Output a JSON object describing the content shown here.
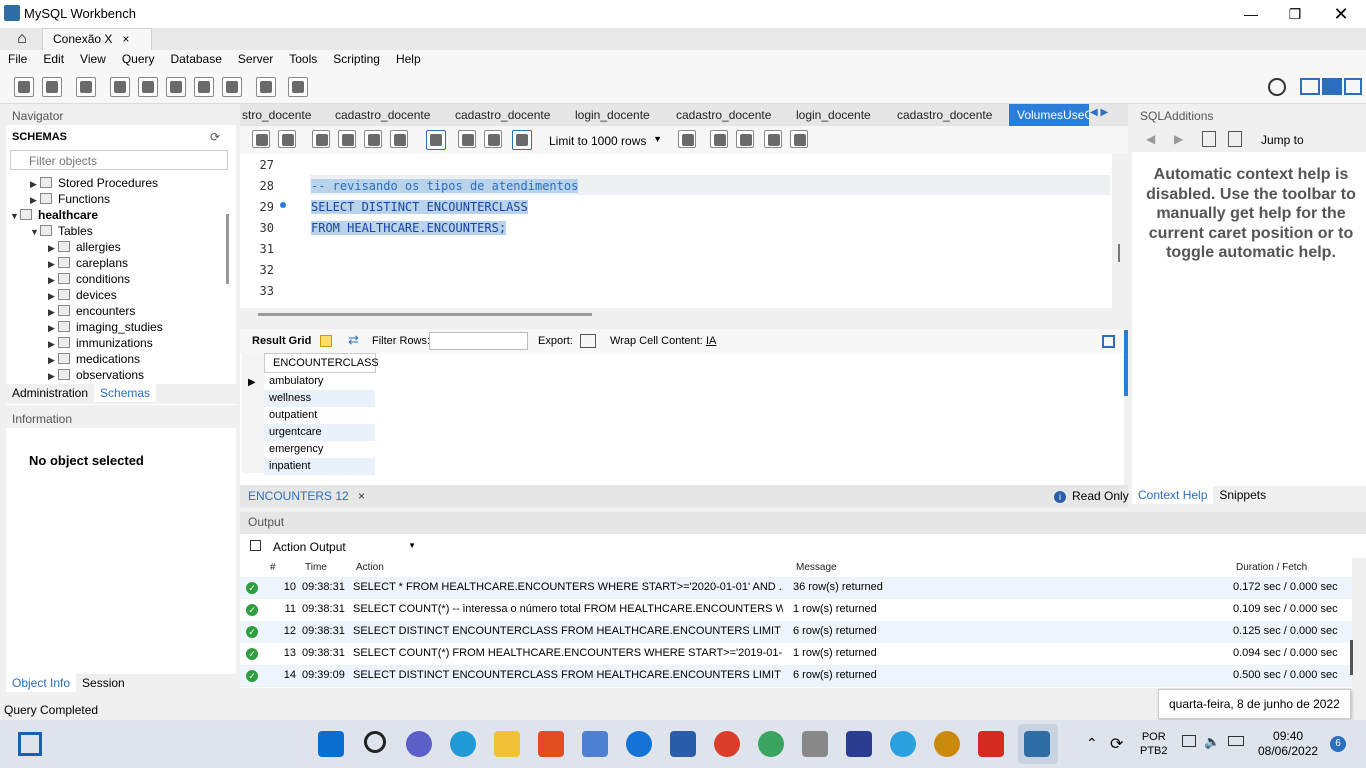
{
  "window": {
    "title": "MySQL Workbench"
  },
  "connection_tab": {
    "label": "Conexão X",
    "close": "×"
  },
  "menu": [
    "File",
    "Edit",
    "View",
    "Query",
    "Database",
    "Server",
    "Tools",
    "Scripting",
    "Help"
  ],
  "navigator": {
    "header": "Navigator",
    "schemas_title": "SCHEMAS",
    "filter_placeholder": "Filter objects",
    "tree": [
      {
        "label": "Stored Procedures",
        "level": 1,
        "bold": false
      },
      {
        "label": "Functions",
        "level": 1,
        "bold": false
      },
      {
        "label": "healthcare",
        "level": 0,
        "bold": true
      },
      {
        "label": "Tables",
        "level": 1,
        "bold": false
      },
      {
        "label": "allergies",
        "level": 2,
        "bold": false
      },
      {
        "label": "careplans",
        "level": 2,
        "bold": false
      },
      {
        "label": "conditions",
        "level": 2,
        "bold": false
      },
      {
        "label": "devices",
        "level": 2,
        "bold": false
      },
      {
        "label": "encounters",
        "level": 2,
        "bold": false
      },
      {
        "label": "imaging_studies",
        "level": 2,
        "bold": false
      },
      {
        "label": "immunizations",
        "level": 2,
        "bold": false
      },
      {
        "label": "medications",
        "level": 2,
        "bold": false
      },
      {
        "label": "observations",
        "level": 2,
        "bold": false
      }
    ],
    "tabs": [
      "Administration",
      "Schemas"
    ]
  },
  "information": {
    "header": "Information",
    "empty": "No object selected",
    "tabs": [
      "Object Info",
      "Session"
    ]
  },
  "query_tabs": [
    "stro_docente",
    "cadastro_docente",
    "cadastro_docente",
    "login_docente",
    "cadastro_docente",
    "login_docente",
    "cadastro_docente",
    "VolumesUseC"
  ],
  "editor_toolbar": {
    "limit": "Limit to 1000 rows"
  },
  "editor": {
    "lines": [
      {
        "n": "27",
        "code": "",
        "kind": ""
      },
      {
        "n": "28",
        "code": "-- revisando os tipos de atendimentos",
        "kind": "cm"
      },
      {
        "n": "29",
        "code": "SELECT DISTINCT ENCOUNTERCLASS",
        "kind": "sel1"
      },
      {
        "n": "30",
        "code": "FROM HEALTHCARE.ENCOUNTERS;",
        "kind": "sel2"
      },
      {
        "n": "31",
        "code": "",
        "kind": ""
      },
      {
        "n": "32",
        "code": "",
        "kind": ""
      },
      {
        "n": "33",
        "code": "",
        "kind": ""
      }
    ]
  },
  "result_toolbar": {
    "grid": "Result Grid",
    "filter": "Filter Rows:",
    "export": "Export:",
    "wrap": "Wrap Cell Content:"
  },
  "result": {
    "column": "ENCOUNTERCLASS",
    "rows": [
      "ambulatory",
      "wellness",
      "outpatient",
      "urgentcare",
      "emergency",
      "inpatient"
    ]
  },
  "result_tabs": {
    "tab": "ENCOUNTERS 12",
    "close": "×",
    "readonly": "Read Only"
  },
  "sql_additions": {
    "header": "SQLAdditions",
    "jump": "Jump to",
    "help": "Automatic context help is disabled. Use the toolbar to manually get help for the current caret position or to toggle automatic help.",
    "tabs": [
      "Context Help",
      "Snippets"
    ]
  },
  "output": {
    "header": "Output",
    "selector": "Action Output",
    "columns": [
      "#",
      "Time",
      "Action",
      "Message",
      "Duration / Fetch"
    ],
    "rows": [
      {
        "n": "10",
        "time": "09:38:31",
        "action": "SELECT * FROM HEALTHCARE.ENCOUNTERS WHERE START>='2020-01-01' AND ...",
        "msg": "36 row(s) returned",
        "dur": "0.172 sec / 0.000 sec"
      },
      {
        "n": "11",
        "time": "09:38:31",
        "action": "SELECT COUNT(*) -- interessa o número total  FROM HEALTHCARE.ENCOUNTERS W...",
        "msg": "1 row(s) returned",
        "dur": "0.109 sec / 0.000 sec"
      },
      {
        "n": "12",
        "time": "09:38:31",
        "action": "SELECT DISTINCT ENCOUNTERCLASS FROM HEALTHCARE.ENCOUNTERS LIMIT ...",
        "msg": "6 row(s) returned",
        "dur": "0.125 sec / 0.000 sec"
      },
      {
        "n": "13",
        "time": "09:38:31",
        "action": "SELECT COUNT(*) FROM HEALTHCARE.ENCOUNTERS WHERE START>='2019-01-...",
        "msg": "1 row(s) returned",
        "dur": "0.094 sec / 0.000 sec"
      },
      {
        "n": "14",
        "time": "09:39:09",
        "action": "SELECT DISTINCT ENCOUNTERCLASS FROM HEALTHCARE.ENCOUNTERS LIMIT ...",
        "msg": "6 row(s) returned",
        "dur": "0.500 sec / 0.000 sec"
      }
    ]
  },
  "status": {
    "text": "Query Completed"
  },
  "tooltip": {
    "text": "quarta-feira, 8 de junho de 2022"
  },
  "taskbar": {
    "lang1": "POR",
    "lang2": "PTB2",
    "time": "09:40",
    "date": "08/06/2022",
    "badge": "6"
  },
  "colors": {
    "accent": "#2a7ed8",
    "ok": "#2e9e3e",
    "selection": "#b9d3ea"
  }
}
